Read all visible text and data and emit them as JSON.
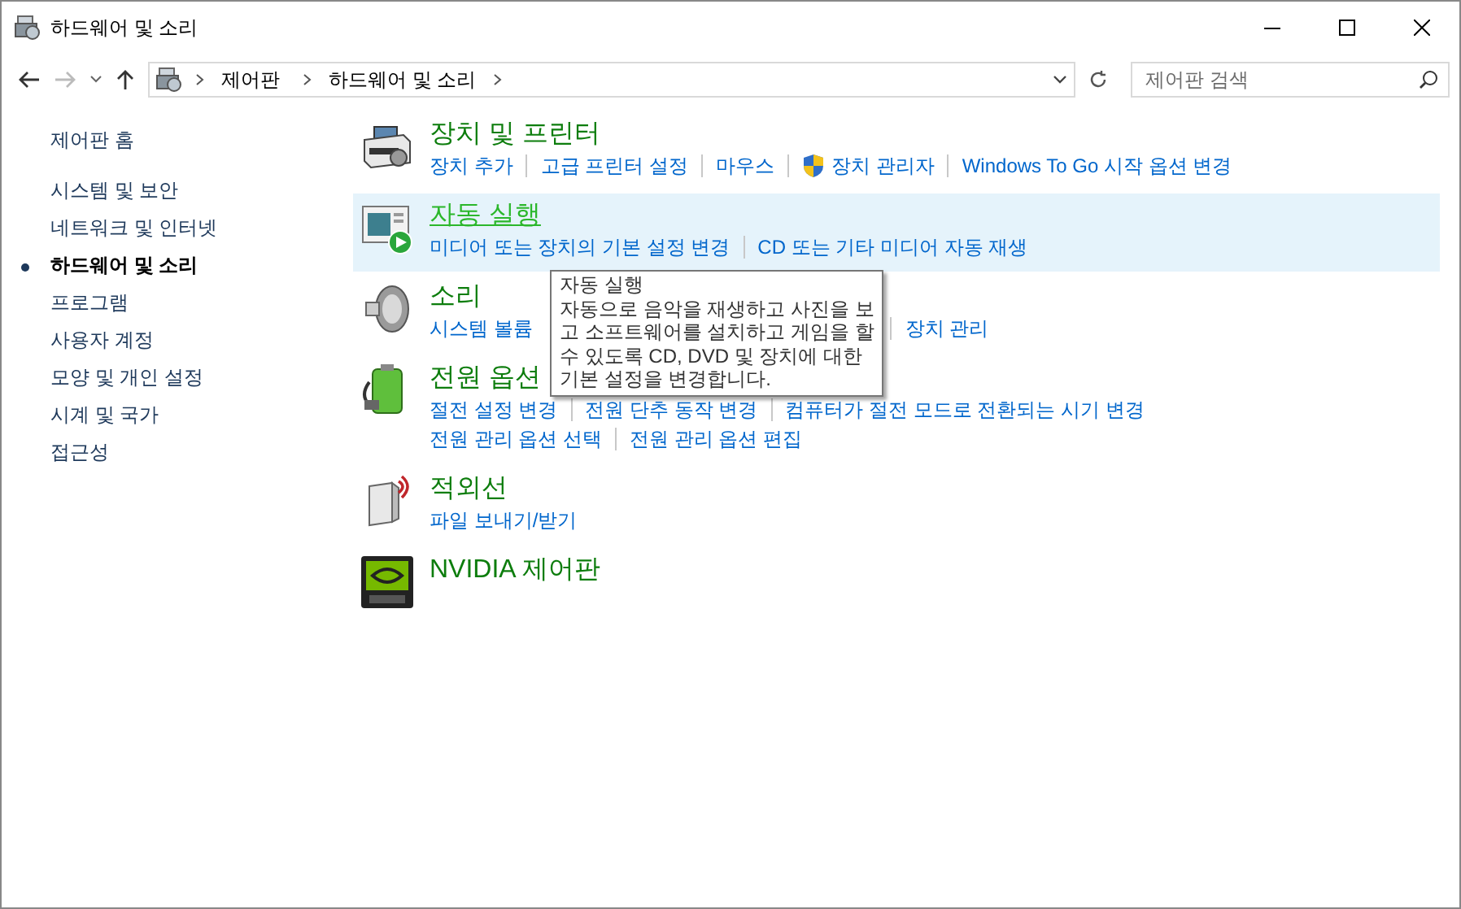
{
  "window": {
    "title": "하드웨어 및 소리"
  },
  "address_bar": {
    "crumbs": [
      "제어판",
      "하드웨어 및 소리"
    ]
  },
  "search": {
    "placeholder": "제어판 검색"
  },
  "sidebar": {
    "items": [
      {
        "label": "제어판 홈",
        "selected": false
      },
      {
        "label": "시스템 및 보안",
        "selected": false
      },
      {
        "label": "네트워크 및 인터넷",
        "selected": false
      },
      {
        "label": "하드웨어 및 소리",
        "selected": true
      },
      {
        "label": "프로그램",
        "selected": false
      },
      {
        "label": "사용자 계정",
        "selected": false
      },
      {
        "label": "모양 및 개인 설정",
        "selected": false
      },
      {
        "label": "시계 및 국가",
        "selected": false
      },
      {
        "label": "접근성",
        "selected": false
      }
    ]
  },
  "categories": [
    {
      "title": "장치 및 프린터",
      "hovered": false,
      "link_rows": [
        [
          {
            "label": "장치 추가",
            "admin": false
          },
          {
            "label": "고급 프린터 설정",
            "admin": false
          },
          {
            "label": "마우스",
            "admin": false
          },
          {
            "label": "장치 관리자",
            "admin": true
          },
          {
            "label": "Windows To Go 시작 옵션 변경",
            "admin": false
          }
        ]
      ]
    },
    {
      "title": "자동 실행",
      "hovered": true,
      "link_rows": [
        [
          {
            "label": "미디어 또는 장치의 기본 설정 변경",
            "admin": false
          },
          {
            "label": "CD 또는 기타 미디어 자동 재생",
            "admin": false
          }
        ]
      ]
    },
    {
      "title": "소리",
      "hovered": false,
      "link_rows": [
        [
          {
            "label": "시스템 볼륨",
            "admin": false
          },
          {
            "label": "장치 관리",
            "admin": false
          }
        ]
      ]
    },
    {
      "title": "전원 옵션",
      "hovered": false,
      "link_rows": [
        [
          {
            "label": "절전 설정 변경",
            "admin": false
          },
          {
            "label": "전원 단추 동작 변경",
            "admin": false
          },
          {
            "label": "컴퓨터가 절전 모드로 전환되는 시기 변경",
            "admin": false
          }
        ],
        [
          {
            "label": "전원 관리 옵션 선택",
            "admin": false
          },
          {
            "label": "전원 관리 옵션 편집",
            "admin": false
          }
        ]
      ]
    },
    {
      "title": "적외선",
      "hovered": false,
      "link_rows": [
        [
          {
            "label": "파일 보내기/받기",
            "admin": false
          }
        ]
      ]
    },
    {
      "title": "NVIDIA 제어판",
      "hovered": false
    }
  ],
  "tooltip": {
    "title": "자동 실행",
    "lines": [
      "자동으로 음악을 재생하고 사진을 보",
      "고 소프트웨어를 설치하고 게임을 할",
      "수 있도록 CD, DVD 및 장치에 대한",
      "기본 설정을 변경합니다."
    ]
  }
}
